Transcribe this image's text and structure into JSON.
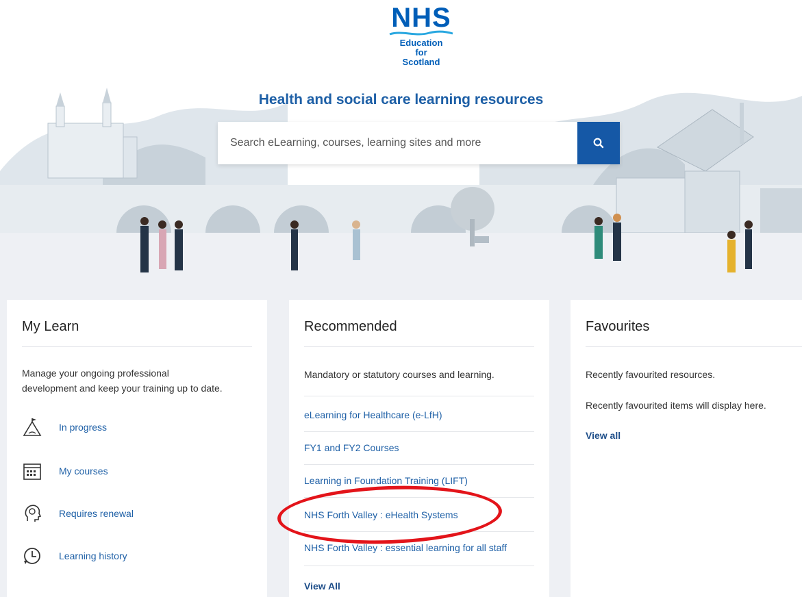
{
  "logo": {
    "brand": "NHS",
    "line1": "Education",
    "line2": "for",
    "line3": "Scotland"
  },
  "hero": {
    "title": "Health and social care learning resources"
  },
  "search": {
    "placeholder": "Search eLearning, courses, learning sites and more",
    "button_icon": "search-icon"
  },
  "my_learn": {
    "title": "My Learn",
    "description_line1": "Manage your ongoing professional",
    "description_line2": "development and keep your training up to date.",
    "items": [
      {
        "label": "In progress",
        "icon": "progress-icon"
      },
      {
        "label": "My courses",
        "icon": "calendar-icon"
      },
      {
        "label": "Requires renewal",
        "icon": "head-icon"
      },
      {
        "label": "Learning history",
        "icon": "history-clock-icon"
      }
    ]
  },
  "recommended": {
    "title": "Recommended",
    "description": "Mandatory or statutory courses and learning.",
    "items": [
      {
        "label": "eLearning for Healthcare (e-LfH)"
      },
      {
        "label": "FY1 and FY2 Courses"
      },
      {
        "label": "Learning in Foundation Training (LIFT)"
      },
      {
        "label": "NHS Forth Valley : eHealth Systems"
      },
      {
        "label": "NHS Forth Valley : essential learning for all staff"
      }
    ],
    "view_all": "View All"
  },
  "favourites": {
    "title": "Favourites",
    "line1": "Recently favourited resources.",
    "line2": "Recently favourited items will display here.",
    "view_all": "View all"
  },
  "colors": {
    "nhs_blue": "#005eb8",
    "link_blue": "#1d5fa6",
    "search_button": "#1558a6",
    "annotation_red": "#e3141a",
    "panel_bg": "#eef0f4"
  }
}
